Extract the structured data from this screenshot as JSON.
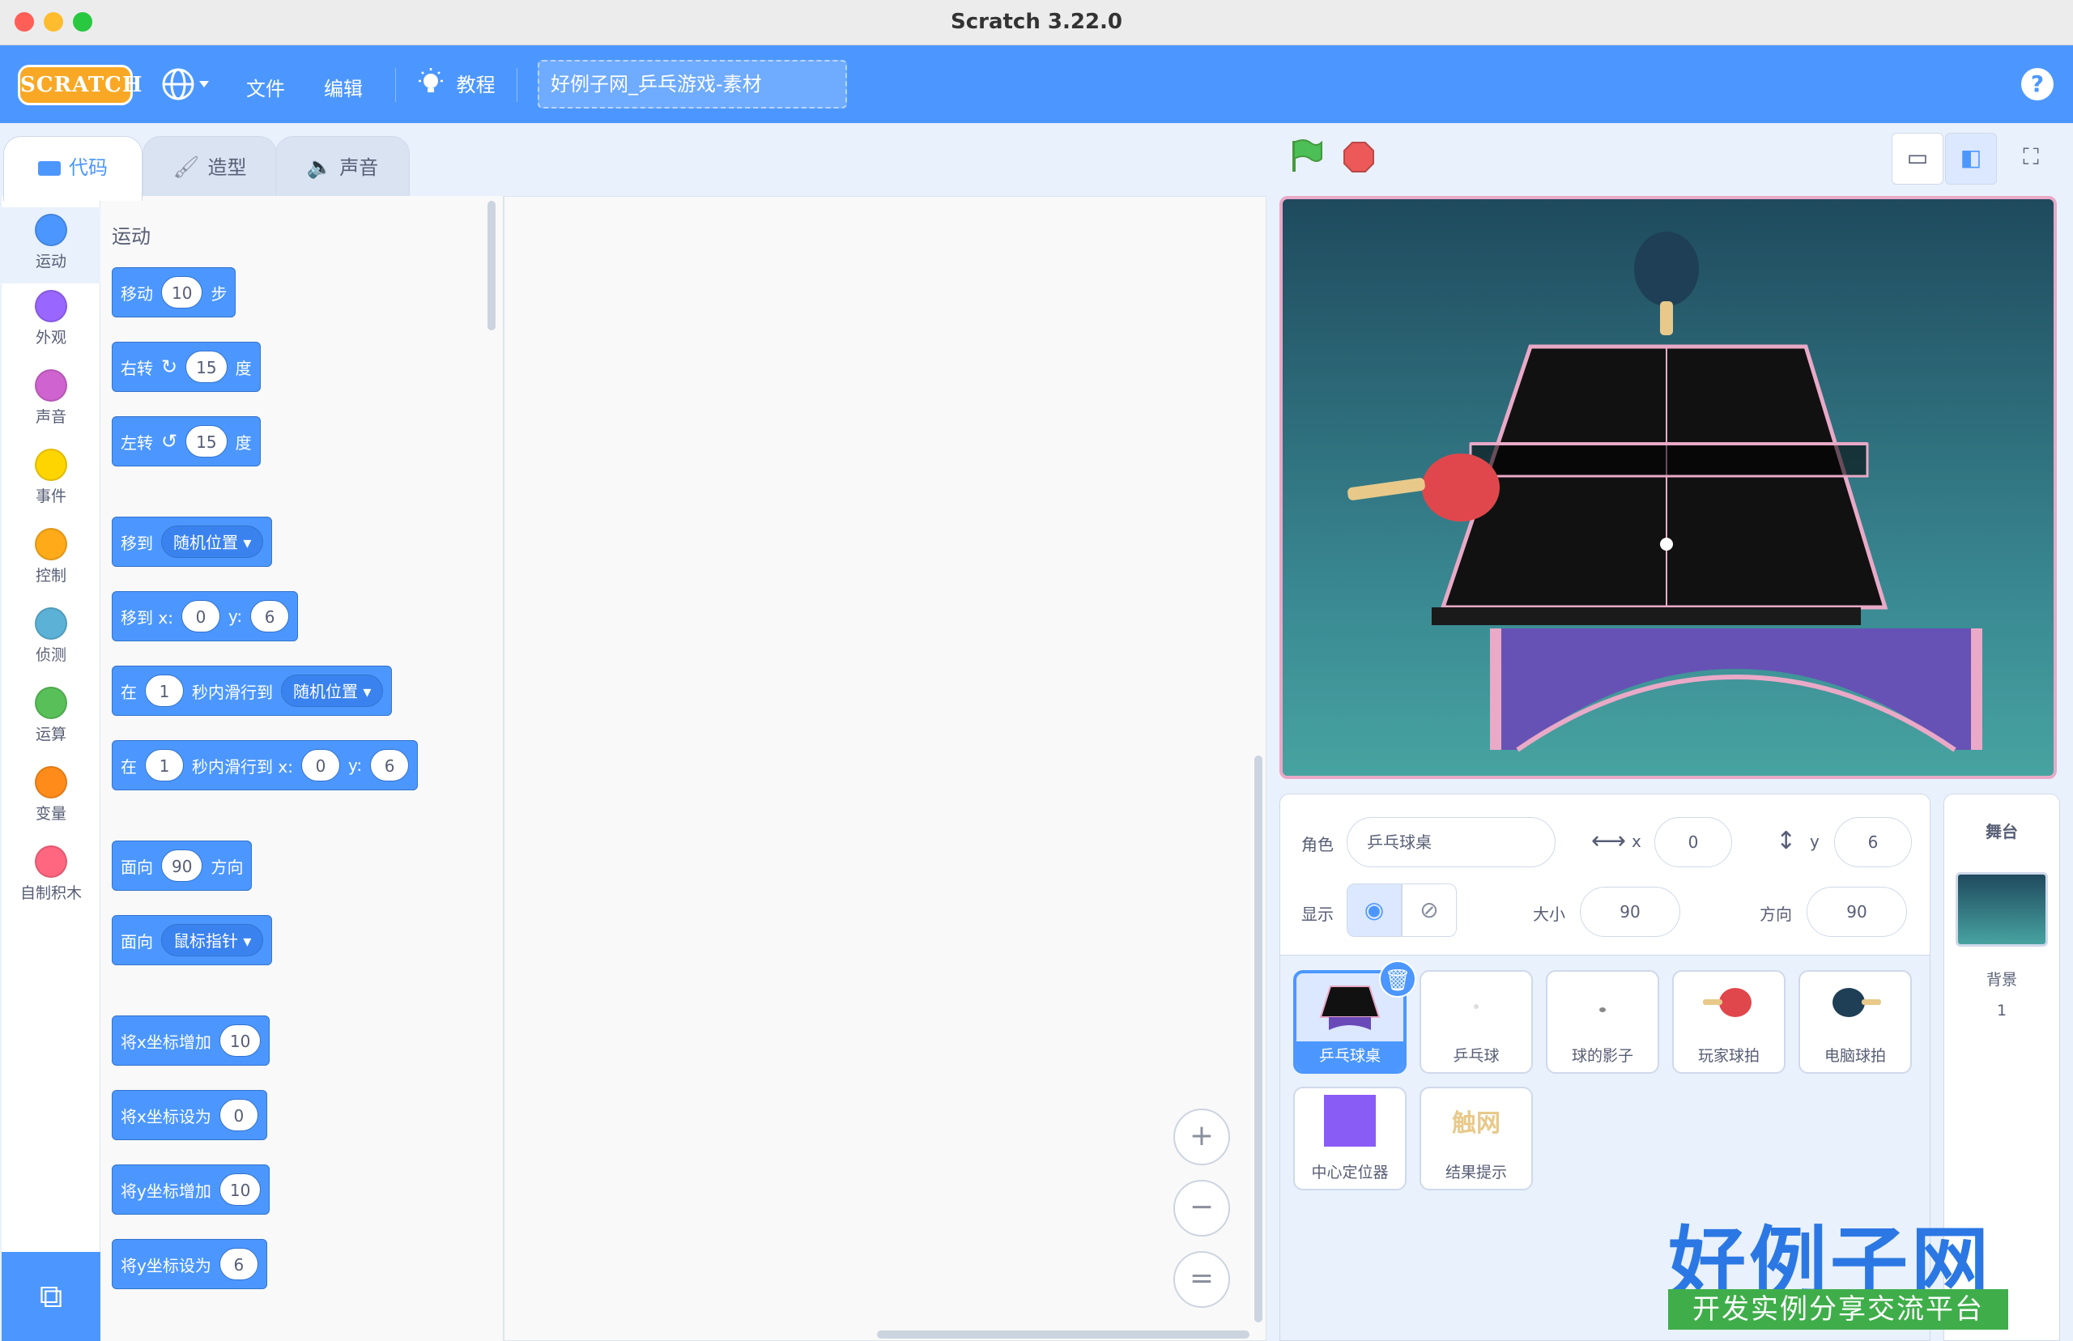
{
  "window": {
    "title": "Scratch 3.22.0"
  },
  "menubar": {
    "logo": "SCRATCH",
    "file": "文件",
    "edit": "编辑",
    "tutorials": "教程",
    "project_title": "好例子网_乒乓游戏-素材",
    "help": "?"
  },
  "tabs": {
    "code": "代码",
    "costumes": "造型",
    "sounds": "声音"
  },
  "categories": [
    {
      "label": "运动",
      "color": "#4c97ff"
    },
    {
      "label": "外观",
      "color": "#9966ff"
    },
    {
      "label": "声音",
      "color": "#cf63cf"
    },
    {
      "label": "事件",
      "color": "#ffd500"
    },
    {
      "label": "控制",
      "color": "#ffab19"
    },
    {
      "label": "侦测",
      "color": "#5cb1d6"
    },
    {
      "label": "运算",
      "color": "#59c059"
    },
    {
      "label": "变量",
      "color": "#ff8c1a"
    },
    {
      "label": "自制积木",
      "color": "#ff6680"
    }
  ],
  "palette": {
    "title": "运动",
    "move": {
      "a": "移动",
      "n": "10",
      "b": "步"
    },
    "turn_right": {
      "a": "右转",
      "n": "15",
      "b": "度"
    },
    "turn_left": {
      "a": "左转",
      "n": "15",
      "b": "度"
    },
    "goto": {
      "a": "移到",
      "dd": "随机位置"
    },
    "goto_xy": {
      "a": "移到 x:",
      "x": "0",
      "ylbl": "y:",
      "y": "6"
    },
    "glide": {
      "a": "在",
      "n": "1",
      "b": "秒内滑行到",
      "dd": "随机位置"
    },
    "glide_xy": {
      "a": "在",
      "n": "1",
      "b": "秒内滑行到 x:",
      "x": "0",
      "ylbl": "y:",
      "y": "6"
    },
    "point_dir": {
      "a": "面向",
      "n": "90",
      "b": "方向"
    },
    "point_towards": {
      "a": "面向",
      "dd": "鼠标指针"
    },
    "change_x": {
      "a": "将x坐标增加",
      "n": "10"
    },
    "set_x": {
      "a": "将x坐标设为",
      "n": "0"
    },
    "change_y": {
      "a": "将y坐标增加",
      "n": "10"
    },
    "set_y": {
      "a": "将y坐标设为",
      "n": "6"
    }
  },
  "zoom": {
    "in": "+",
    "out": "−",
    "reset": "="
  },
  "sprite_info": {
    "sprite_label": "角色",
    "sprite_name": "乒乓球桌",
    "x_label": "x",
    "x": "0",
    "y_label": "y",
    "y": "6",
    "show_label": "显示",
    "size_label": "大小",
    "size": "90",
    "direction_label": "方向",
    "direction": "90"
  },
  "sprites": [
    {
      "name": "乒乓球桌"
    },
    {
      "name": "乒乓球"
    },
    {
      "name": "球的影子"
    },
    {
      "name": "玩家球拍"
    },
    {
      "name": "电脑球拍"
    },
    {
      "name": "中心定位器"
    },
    {
      "name": "结果提示",
      "thumb_text": "触网"
    }
  ],
  "stage_panel": {
    "title": "舞台",
    "backdrops_label": "背景",
    "backdrops_count": "1"
  },
  "watermark": {
    "line1": "好例子网",
    "line2": "开发实例分享交流平台"
  }
}
